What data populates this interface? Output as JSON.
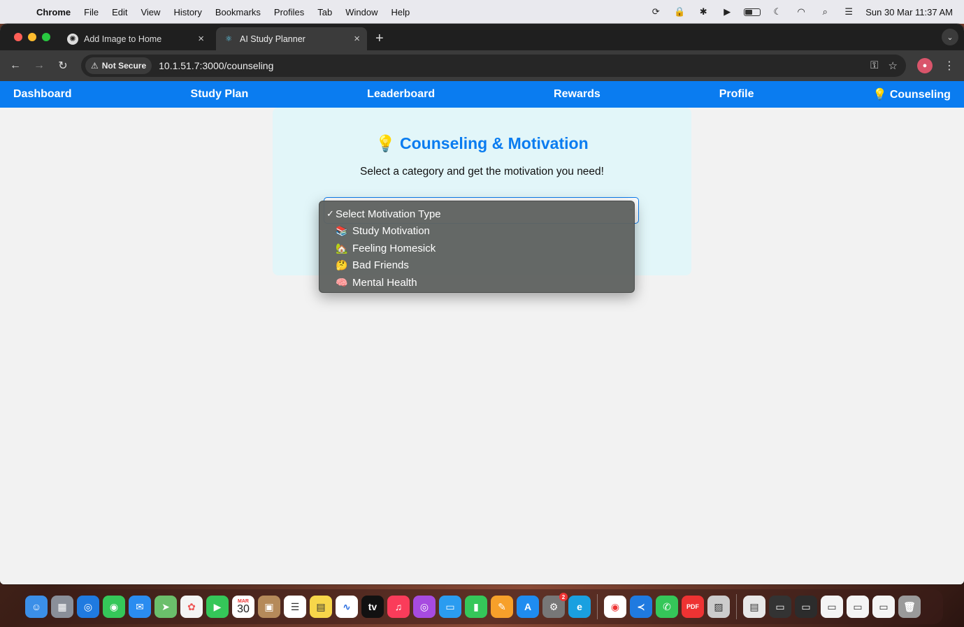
{
  "menubar": {
    "app": "Chrome",
    "items": [
      "File",
      "Edit",
      "View",
      "History",
      "Bookmarks",
      "Profiles",
      "Tab",
      "Window",
      "Help"
    ],
    "datetime": "Sun 30 Mar  11:37 AM"
  },
  "tabs": [
    {
      "title": "Add Image to Home",
      "favicon": "openai-icon"
    },
    {
      "title": "AI Study Planner",
      "favicon": "react-icon"
    }
  ],
  "toolbar": {
    "security_label": "Not Secure",
    "url": "10.1.51.7:3000/counseling"
  },
  "nav": {
    "items": [
      "Dashboard",
      "Study Plan",
      "Leaderboard",
      "Rewards",
      "Profile",
      "💡 Counseling"
    ]
  },
  "card": {
    "title_icon": "💡",
    "title": "Counseling & Motivation",
    "subtitle": "Select a category and get the motivation you need!"
  },
  "dropdown": {
    "options": [
      {
        "emoji": "",
        "label": "Select Motivation Type",
        "selected": true
      },
      {
        "emoji": "📚",
        "label": "Study Motivation"
      },
      {
        "emoji": "🏡",
        "label": "Feeling Homesick"
      },
      {
        "emoji": "🤔",
        "label": "Bad Friends"
      },
      {
        "emoji": "🧠",
        "label": "Mental Health"
      }
    ],
    "check_mark": "✓"
  },
  "dock": {
    "calendar_month": "MAR",
    "calendar_day": "30",
    "settings_badge": "2"
  }
}
